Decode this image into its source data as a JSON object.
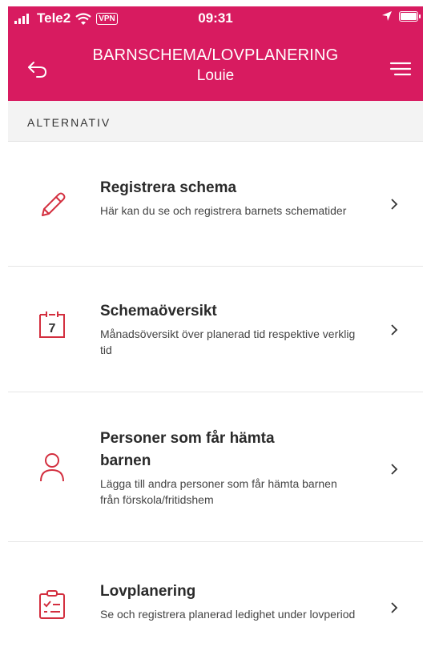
{
  "status": {
    "carrier": "Tele2",
    "vpn": "VPN",
    "time": "09:31"
  },
  "header": {
    "title": "BARNSCHEMA/LOVPLANERING",
    "subtitle": "Louie"
  },
  "section": {
    "label": "ALTERNATIV"
  },
  "items": [
    {
      "title": "Registrera schema",
      "description": "Här kan du se och registrera barnets schematider",
      "icon": "pencil-icon"
    },
    {
      "title": "Schemaöversikt",
      "description": "Månadsöversikt över planerad tid respektive verklig tid",
      "icon": "calendar-icon",
      "calendar_day": "7"
    },
    {
      "title": "Personer som får hämta barnen",
      "description": "Lägga till andra personer som får hämta barnen från förskola/fritidshem",
      "icon": "person-icon"
    },
    {
      "title": "Lovplanering",
      "description": "Se och registrera planerad ledighet under lovperiod",
      "icon": "clipboard-icon"
    }
  ],
  "colors": {
    "brand": "#d81b60",
    "icon": "#d32f3f"
  }
}
